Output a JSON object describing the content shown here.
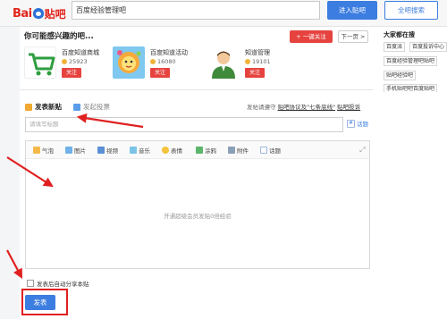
{
  "header": {
    "logo_text_bai": "Bai",
    "logo_text_tieba": "贴吧",
    "search_value": "百度经验管理吧",
    "enter_bar_label": "进入贴吧",
    "search_all_label": "全吧搜索"
  },
  "interest": {
    "title": "你可能感兴趣的吧...",
    "follow_all_label": "+ 一键关注",
    "next_page_label": "下一页 >",
    "bars": [
      {
        "name": "百度知道商城",
        "count": "25923",
        "follow": "关注",
        "thumb_color": "#ffffff",
        "icon": "shopping-cart-icon"
      },
      {
        "name": "百度知道活动",
        "count": "16080",
        "follow": "关注",
        "thumb_color": "#7fc8f0",
        "icon": "lion-cartoon-icon"
      },
      {
        "name": "知道管理",
        "count": "19101",
        "follow": "关注",
        "thumb_color": "#ffffff",
        "icon": "person-avatar-icon"
      }
    ]
  },
  "sidebar": {
    "title": "大家都在搜",
    "tags": [
      "百度派",
      "百度投诉中心",
      "百度经验管理吧贴吧",
      "贴吧经验吧",
      "手机贴吧吧百度贴吧"
    ]
  },
  "composer": {
    "tab_post": "发表新贴",
    "tab_vote": "发起投票",
    "notice_prefix": "发帖请遵守",
    "notice_link1": "贴吧协议及\"七条底线\"",
    "notice_link2": "贴吧投诉",
    "title_placeholder": "请填写标题",
    "topic_label": "话题",
    "toolbar": [
      "气泡",
      "图片",
      "视频",
      "音乐",
      "表情",
      "涂鸦",
      "附件",
      "话题"
    ],
    "editor_placeholder": "开通超级会员发贴0倍经验",
    "auto_share_label": "发表后自动分享本贴",
    "submit_label": "发表"
  },
  "colors": {
    "accent_blue": "#3b7de0",
    "follow_red": "#e6433f",
    "annotation_red": "#e02020"
  }
}
